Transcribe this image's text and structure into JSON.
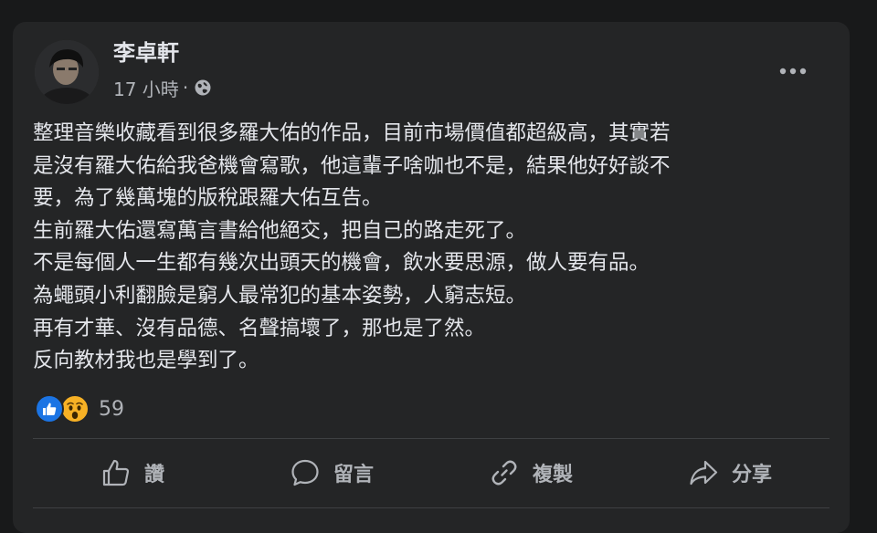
{
  "post": {
    "author": "李卓軒",
    "time": "17 小時",
    "meta_separator": "·",
    "privacy_icon": "globe-icon",
    "lines": [
      "整理音樂收藏看到很多羅大佑的作品，目前市場價值都超級高，其實若",
      "是沒有羅大佑給我爸機會寫歌，他這輩子啥咖也不是，結果他好好談不",
      "要，為了幾萬塊的版稅跟羅大佑互告。",
      "生前羅大佑還寫萬言書給他絕交，把自己的路走死了。",
      "不是每個人一生都有幾次出頭天的機會，飲水要思源，做人要有品。",
      "為蠅頭小利翻臉是窮人最常犯的基本姿勢，人窮志短。",
      "再有才華、沒有品德、名聲搞壞了，那也是了然。",
      "反向教材我也是學到了。"
    ]
  },
  "reactions": {
    "types": [
      "like",
      "wow"
    ],
    "count": "59"
  },
  "actions": {
    "like": "讚",
    "comment": "留言",
    "copy": "複製",
    "share": "分享"
  },
  "colors": {
    "page_bg": "#18191a",
    "card_bg": "#242526",
    "text_primary": "#e4e6eb",
    "text_secondary": "#b0b3b8",
    "like_blue": "#1b74e4",
    "wow_yellow": "#f7b125"
  }
}
